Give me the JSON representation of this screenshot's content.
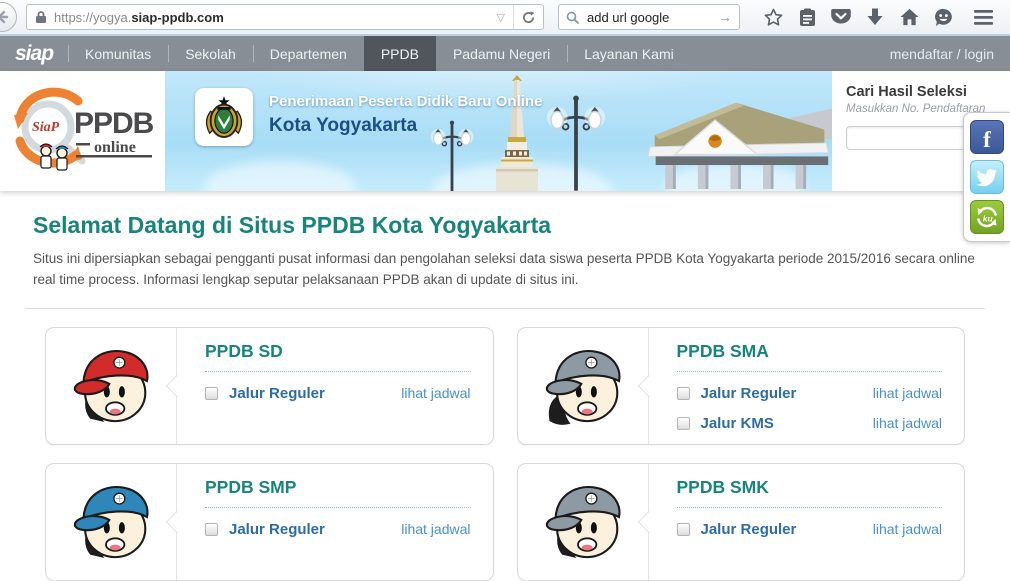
{
  "browser": {
    "url": {
      "prefix": "https://yogya.",
      "domain": "siap-ppdb.com"
    },
    "search_value": "add url google",
    "toolbar_icons": [
      "back-icon",
      "lock-icon",
      "bookmark-dropdown-icon",
      "reload-icon",
      "magnifier-icon",
      "go-arrow-icon",
      "star-icon",
      "bookmarks-clipboard-icon",
      "pocket-icon",
      "download-icon",
      "home-icon",
      "hello-chat-icon",
      "hamburger-menu-icon"
    ]
  },
  "nav": {
    "brand": "siap",
    "items": [
      {
        "label": "Komunitas",
        "active": false
      },
      {
        "label": "Sekolah",
        "active": false
      },
      {
        "label": "Departemen",
        "active": false
      },
      {
        "label": "PPDB",
        "active": true
      },
      {
        "label": "Padamu Negeri",
        "active": false
      },
      {
        "label": "Layanan Kami",
        "active": false
      }
    ],
    "auth_label": "mendaftar / login"
  },
  "banner": {
    "logo_title": "PPDB",
    "logo_subtitle": "online",
    "title": "Penerimaan Peserta Didik Baru Online",
    "subtitle": "Kota Yogyakarta",
    "search_title": "Cari Hasil Seleksi",
    "search_hint": "Masukkan No. Pendaftaran",
    "search_value": ""
  },
  "social": {
    "icons": [
      "facebook-icon",
      "twitter-icon",
      "kaskus-icon"
    ]
  },
  "main": {
    "heading": "Selamat Datang di Situs PPDB Kota Yogyakarta",
    "intro": "Situs ini dipersiapkan sebagai pengganti pusat informasi dan pengolahan seleksi data siswa peserta PPDB Kota Yogyakarta periode 2015/2016 secara online real time process. Informasi lengkap seputar pelaksanaan PPDB akan di update di situs ini."
  },
  "cards": [
    {
      "title": "PPDB SD",
      "avatar": "boy-red-cap",
      "cap_color": "#d22b2b",
      "rows": [
        {
          "label": "Jalur Reguler",
          "link": "lihat jadwal"
        }
      ]
    },
    {
      "title": "PPDB SMA",
      "avatar": "girl-gray-cap",
      "cap_color": "#8d99a3",
      "rows": [
        {
          "label": "Jalur Reguler",
          "link": "lihat jadwal"
        },
        {
          "label": "Jalur KMS",
          "link": "lihat jadwal"
        }
      ]
    },
    {
      "title": "PPDB SMP",
      "avatar": "boy-blue-cap",
      "cap_color": "#2f86b8",
      "rows": [
        {
          "label": "Jalur Reguler",
          "link": "lihat jadwal"
        }
      ]
    },
    {
      "title": "PPDB SMK",
      "avatar": "boy-gray-cap",
      "cap_color": "#8d99a3",
      "rows": [
        {
          "label": "Jalur Reguler",
          "link": "lihat jadwal"
        }
      ]
    }
  ],
  "colors": {
    "heading_teal": "#17857b",
    "link_bold_blue": "#2e6da4",
    "link_light_blue": "#4a90c9",
    "nav_bg": "#878e95",
    "nav_active": "#50565c",
    "banner_navy": "#1c4f86",
    "facebook_blue": "#3b5998",
    "twitter_blue": "#74d0ef",
    "kaskus_green": "#74a326"
  }
}
